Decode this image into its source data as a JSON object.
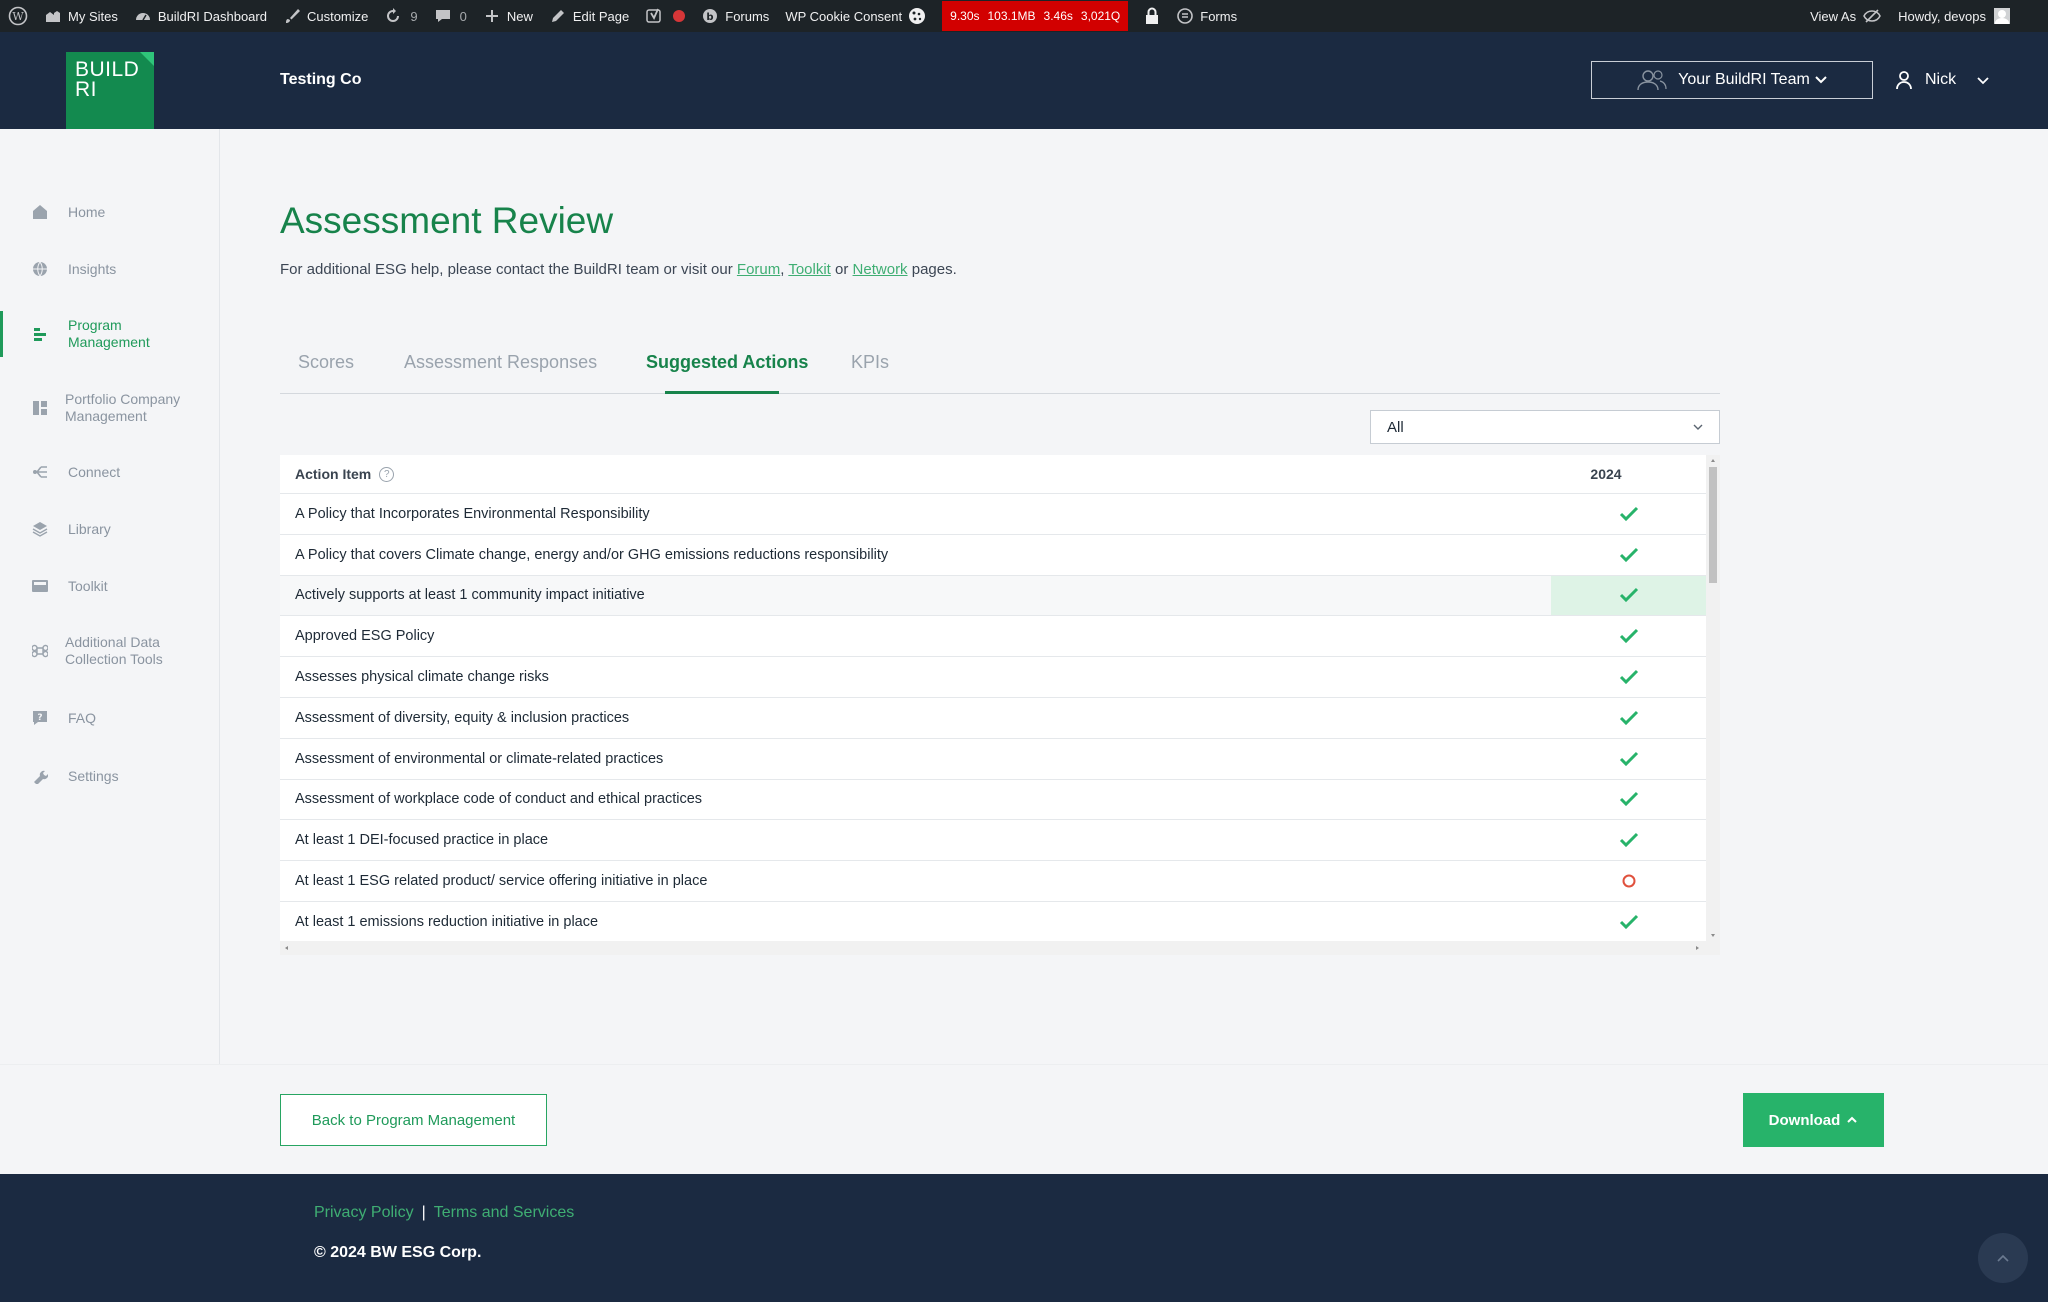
{
  "adminbar": {
    "my_sites": "My Sites",
    "dashboard": "BuildRI Dashboard",
    "customize": "Customize",
    "updates_count": "9",
    "comments_count": "0",
    "new": "New",
    "edit_page": "Edit Page",
    "forums": "Forums",
    "cookie_consent": "WP Cookie Consent",
    "perf": [
      "9.30s",
      "103.1MB",
      "3.46s",
      "3,021Q"
    ],
    "forms": "Forms",
    "view_as": "View As",
    "howdy": "Howdy, devops"
  },
  "header": {
    "logo_line1": "BUILD",
    "logo_line2": "RI",
    "company": "Testing Co",
    "team_button": "Your BuildRI Team",
    "user_name": "Nick"
  },
  "sidebar": {
    "items": [
      {
        "label": "Home",
        "icon": "home-icon"
      },
      {
        "label": "Insights",
        "icon": "globe-icon"
      },
      {
        "label": "Program Management",
        "icon": "program-icon",
        "active": true
      },
      {
        "label": "Portfolio Company Management",
        "icon": "grid-icon"
      },
      {
        "label": "Connect",
        "icon": "connect-icon"
      },
      {
        "label": "Library",
        "icon": "layers-icon"
      },
      {
        "label": "Toolkit",
        "icon": "toolkit-icon"
      },
      {
        "label": "Additional Data Collection Tools",
        "icon": "command-icon"
      },
      {
        "label": "FAQ",
        "icon": "faq-icon"
      },
      {
        "label": "Settings",
        "icon": "wrench-icon"
      }
    ]
  },
  "main": {
    "title": "Assessment Review",
    "help_prefix": "For additional ESG help, please contact the BuildRI team or visit our ",
    "help_link_forum": "Forum",
    "help_comma": ", ",
    "help_link_toolkit": "Toolkit",
    "help_or": " or ",
    "help_link_network": "Network",
    "help_suffix": " pages.",
    "tabs": [
      {
        "label": "Scores"
      },
      {
        "label": "Assessment Responses"
      },
      {
        "label": "Suggested Actions",
        "active": true
      },
      {
        "label": "KPIs"
      }
    ],
    "filter_value": "All",
    "table": {
      "col_item": "Action Item",
      "col_year": "2024",
      "rows": [
        {
          "item": "A Policy that Incorporates Environmental Responsibility",
          "status": "check"
        },
        {
          "item": "A Policy that covers Climate change, energy and/or GHG emissions reductions responsibility",
          "status": "check"
        },
        {
          "item": "Actively supports at least 1 community impact initiative",
          "status": "check"
        },
        {
          "item": "Approved ESG Policy",
          "status": "check"
        },
        {
          "item": "Assesses physical climate change risks",
          "status": "check"
        },
        {
          "item": "Assessment of diversity, equity & inclusion practices",
          "status": "check"
        },
        {
          "item": "Assessment of environmental or climate-related practices",
          "status": "check"
        },
        {
          "item": "Assessment of workplace code of conduct and ethical practices",
          "status": "check"
        },
        {
          "item": "At least 1 DEI-focused practice in place",
          "status": "check"
        },
        {
          "item": "At least 1 ESG related product/ service offering initiative in place",
          "status": "circle"
        },
        {
          "item": "At least 1 emissions reduction initiative in place",
          "status": "check"
        }
      ]
    }
  },
  "actions": {
    "back": "Back to Program Management",
    "download": "Download"
  },
  "footer": {
    "privacy": "Privacy Policy",
    "separator": "|",
    "terms": "Terms and Services",
    "copyright": "© 2024 BW ESG Corp."
  },
  "colors": {
    "brand_green": "#17834b",
    "nav_bg": "#1b2a41",
    "check_green": "#27b36a",
    "circle_red": "#e0513d"
  }
}
